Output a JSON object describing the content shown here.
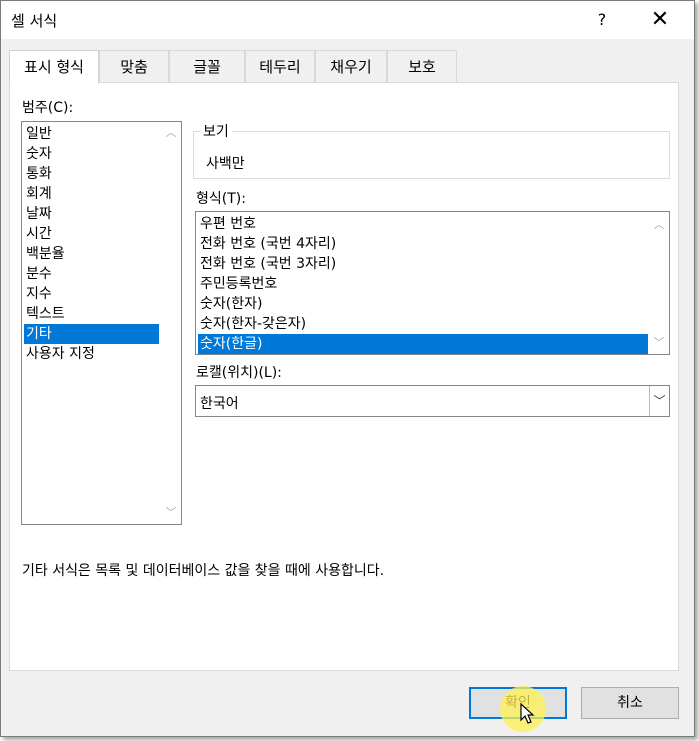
{
  "window": {
    "title": "셀 서식",
    "help_label": "?",
    "close_label": "✕"
  },
  "tabs": [
    {
      "label": "표시 형식",
      "active": true
    },
    {
      "label": "맞춤",
      "active": false
    },
    {
      "label": "글꼴",
      "active": false
    },
    {
      "label": "테두리",
      "active": false
    },
    {
      "label": "채우기",
      "active": false
    },
    {
      "label": "보호",
      "active": false
    }
  ],
  "category": {
    "label": "범주(C):",
    "items": [
      "일반",
      "숫자",
      "통화",
      "회계",
      "날짜",
      "시간",
      "백분율",
      "분수",
      "지수",
      "텍스트",
      "기타",
      "사용자 지정"
    ],
    "selected": "기타"
  },
  "sample": {
    "label": "보기",
    "value": "사백만"
  },
  "type": {
    "label": "형식(T):",
    "items": [
      "우편 번호",
      "전화 번호 (국번 4자리)",
      "전화 번호 (국번 3자리)",
      "주민등록번호",
      "숫자(한자)",
      "숫자(한자-갖은자)",
      "숫자(한글)"
    ],
    "selected": "숫자(한글)"
  },
  "locale": {
    "label": "로캘(위치)(L):",
    "value": "한국어"
  },
  "description": "기타 서식은 목록 및 데이터베이스 값을 찾을 때에 사용합니다.",
  "buttons": {
    "ok": "확인",
    "cancel": "취소"
  },
  "colors": {
    "selection": "#0078d7",
    "accent": "#0078d7"
  }
}
